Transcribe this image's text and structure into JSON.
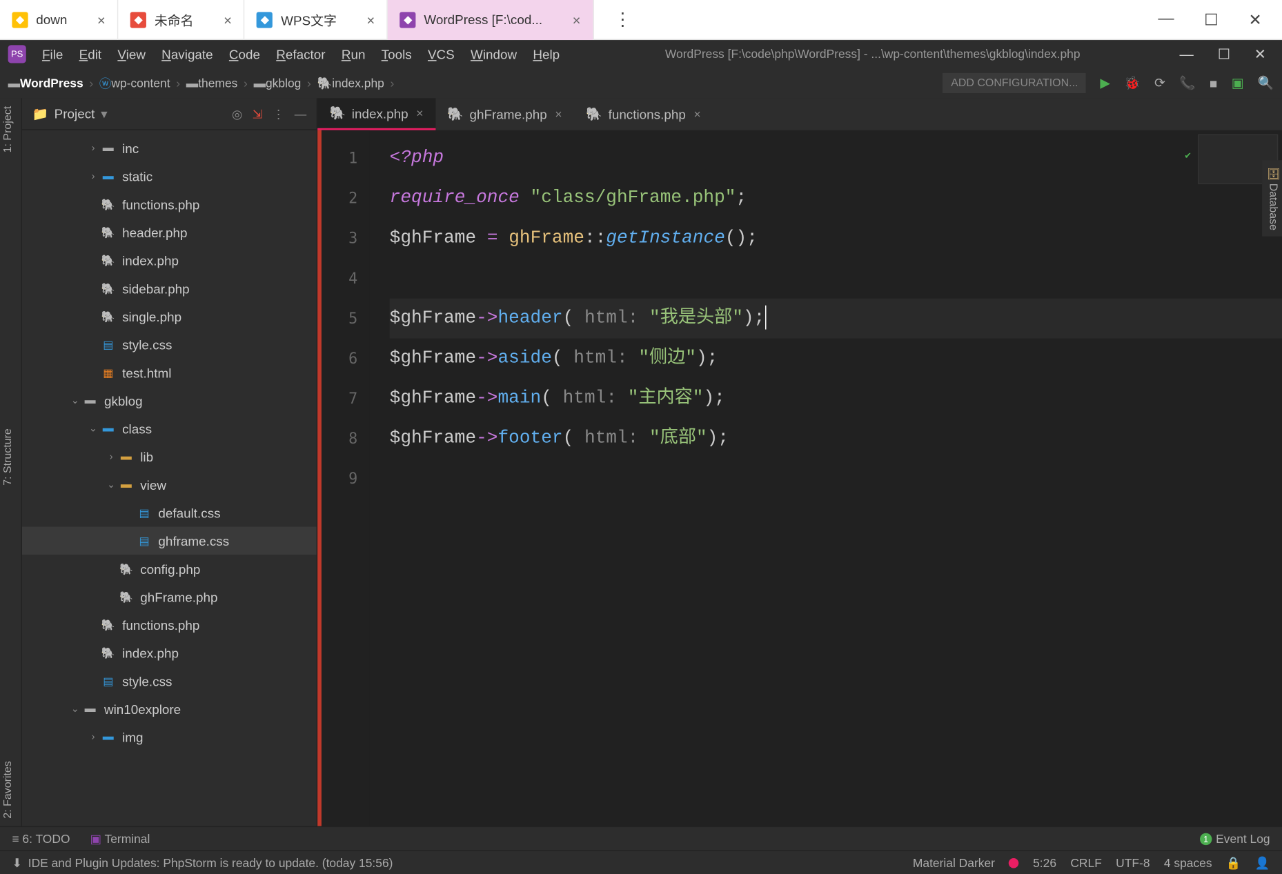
{
  "win_tabs": [
    {
      "label": "down",
      "icon_bg": "#ffc107"
    },
    {
      "label": "未命名",
      "icon_bg": "#e74c3c"
    },
    {
      "label": "WPS文字",
      "icon_bg": "#3498db"
    },
    {
      "label": "WordPress [F:\\cod...",
      "icon_bg": "#8e44ad",
      "active": true
    }
  ],
  "menu": [
    "File",
    "Edit",
    "View",
    "Navigate",
    "Code",
    "Refactor",
    "Run",
    "Tools",
    "VCS",
    "Window",
    "Help"
  ],
  "title_path": "WordPress [F:\\code\\php\\WordPress] - ...\\wp-content\\themes\\gkblog\\index.php",
  "crumbs": [
    {
      "icon": "folder",
      "label": "WordPress"
    },
    {
      "icon": "wp",
      "label": "wp-content"
    },
    {
      "icon": "folder",
      "label": "themes"
    },
    {
      "icon": "folder",
      "label": "gkblog"
    },
    {
      "icon": "php",
      "label": "index.php"
    }
  ],
  "add_cfg": "ADD CONFIGURATION...",
  "project_label": "Project",
  "sidebar_left": [
    {
      "label": "1: Project"
    },
    {
      "label": "7: Structure"
    },
    {
      "label": "2: Favorites"
    }
  ],
  "sidebar_right": "Database",
  "tree": [
    {
      "indent": 3,
      "arrow": "›",
      "icon": "folder",
      "iconClass": "fold-ico",
      "label": "inc"
    },
    {
      "indent": 3,
      "arrow": "›",
      "icon": "folder-s",
      "iconClass": "css-ico",
      "label": "static"
    },
    {
      "indent": 3,
      "arrow": "",
      "icon": "php",
      "iconClass": "php-ico",
      "label": "functions.php"
    },
    {
      "indent": 3,
      "arrow": "",
      "icon": "php",
      "iconClass": "php-ico",
      "label": "header.php"
    },
    {
      "indent": 3,
      "arrow": "",
      "icon": "php",
      "iconClass": "php-ico",
      "label": "index.php"
    },
    {
      "indent": 3,
      "arrow": "",
      "icon": "php",
      "iconClass": "php-ico",
      "label": "sidebar.php"
    },
    {
      "indent": 3,
      "arrow": "",
      "icon": "php",
      "iconClass": "php-ico",
      "label": "single.php"
    },
    {
      "indent": 3,
      "arrow": "",
      "icon": "css",
      "iconClass": "css-ico",
      "label": "style.css"
    },
    {
      "indent": 3,
      "arrow": "",
      "icon": "html",
      "iconClass": "html-ico",
      "label": "test.html"
    },
    {
      "indent": 2,
      "arrow": "⌄",
      "icon": "folder",
      "iconClass": "fold-ico",
      "label": "gkblog"
    },
    {
      "indent": 3,
      "arrow": "⌄",
      "icon": "folder",
      "iconClass": "css-ico",
      "label": "class"
    },
    {
      "indent": 4,
      "arrow": "›",
      "icon": "folder",
      "iconClass": "fold-open",
      "label": "lib"
    },
    {
      "indent": 4,
      "arrow": "⌄",
      "icon": "folder",
      "iconClass": "fold-open",
      "label": "view"
    },
    {
      "indent": 5,
      "arrow": "",
      "icon": "css",
      "iconClass": "css-ico",
      "label": "default.css"
    },
    {
      "indent": 5,
      "arrow": "",
      "icon": "css",
      "iconClass": "css-ico",
      "label": "ghframe.css",
      "selected": true
    },
    {
      "indent": 4,
      "arrow": "",
      "icon": "php",
      "iconClass": "php-ico",
      "label": "config.php"
    },
    {
      "indent": 4,
      "arrow": "",
      "icon": "php",
      "iconClass": "css-ico",
      "label": "ghFrame.php"
    },
    {
      "indent": 3,
      "arrow": "",
      "icon": "php",
      "iconClass": "php-ico",
      "label": "functions.php"
    },
    {
      "indent": 3,
      "arrow": "",
      "icon": "php",
      "iconClass": "php-ico",
      "label": "index.php"
    },
    {
      "indent": 3,
      "arrow": "",
      "icon": "css",
      "iconClass": "css-ico",
      "label": "style.css"
    },
    {
      "indent": 2,
      "arrow": "⌄",
      "icon": "folder",
      "iconClass": "fold-ico",
      "label": "win10explore"
    },
    {
      "indent": 3,
      "arrow": "›",
      "icon": "folder",
      "iconClass": "css-ico",
      "label": "img"
    }
  ],
  "editor_tabs": [
    {
      "label": "index.php",
      "active": true
    },
    {
      "label": "ghFrame.php"
    },
    {
      "label": "functions.php"
    }
  ],
  "code_lines_count": 9,
  "code": {
    "l1": "<?php",
    "l2_kw": "require_once",
    "l2_str": "\"class/ghFrame.php\"",
    "l3_var": "$ghFrame",
    "l3_cls": "ghFrame",
    "l3_mtd": "getInstance",
    "l5_var": "$ghFrame",
    "l5_fn": "header",
    "l5_hint": "html:",
    "l5_str": "\"我是头部\"",
    "l6_var": "$ghFrame",
    "l6_fn": "aside",
    "l6_hint": "html:",
    "l6_str": "\"侧边\"",
    "l7_var": "$ghFrame",
    "l7_fn": "main",
    "l7_hint": "html:",
    "l7_str": "\"主内容\"",
    "l8_var": "$ghFrame",
    "l8_fn": "footer",
    "l8_hint": "html:",
    "l8_str": "\"底部\""
  },
  "bottom": {
    "todo": "6: TODO",
    "terminal": "Terminal",
    "eventlog": "Event Log"
  },
  "status": {
    "msg": "IDE and Plugin Updates: PhpStorm is ready to update. (today 15:56)",
    "theme": "Material Darker",
    "pos": "5:26",
    "eol": "CRLF",
    "enc": "UTF-8",
    "indent": "4 spaces"
  }
}
